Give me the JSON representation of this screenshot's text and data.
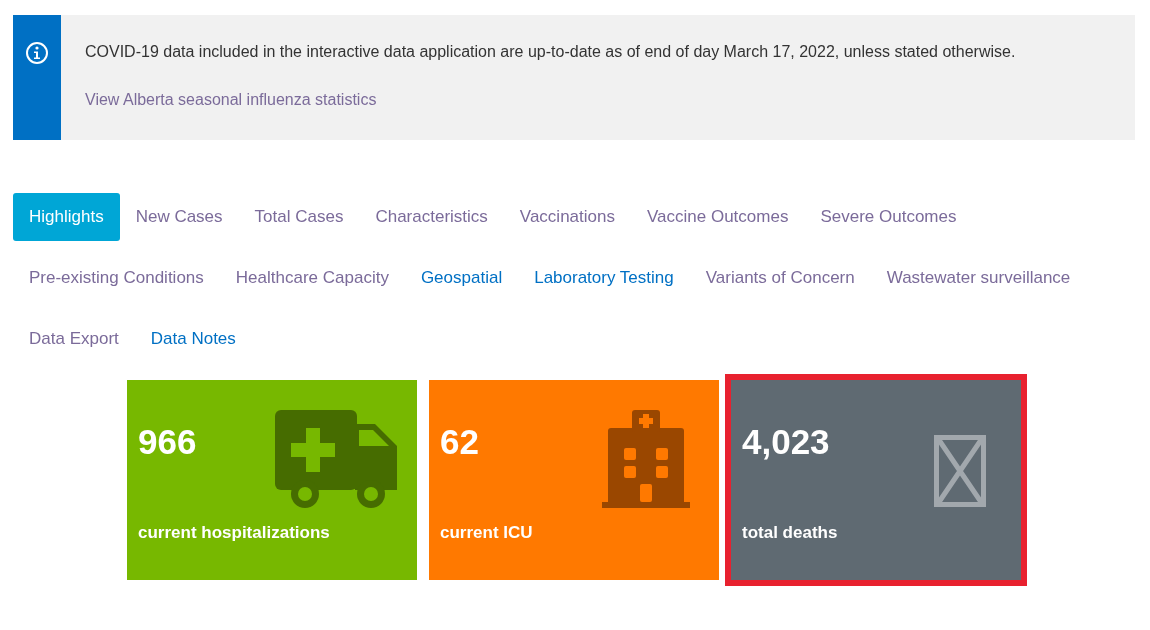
{
  "notice": {
    "message": "COVID-19 data included in the interactive data application are up-to-date as of end of day March 17, 2022, unless stated otherwise.",
    "link": "View Alberta seasonal influenza statistics"
  },
  "tabs": [
    {
      "label": "Highlights",
      "selected": true,
      "visited": false
    },
    {
      "label": "New Cases",
      "selected": false,
      "visited": true
    },
    {
      "label": "Total Cases",
      "selected": false,
      "visited": true
    },
    {
      "label": "Characteristics",
      "selected": false,
      "visited": true
    },
    {
      "label": "Vaccinations",
      "selected": false,
      "visited": true
    },
    {
      "label": "Vaccine Outcomes",
      "selected": false,
      "visited": true
    },
    {
      "label": "Severe Outcomes",
      "selected": false,
      "visited": true
    },
    {
      "label": "Pre-existing Conditions",
      "selected": false,
      "visited": true
    },
    {
      "label": "Healthcare Capacity",
      "selected": false,
      "visited": true
    },
    {
      "label": "Geospatial",
      "selected": false,
      "visited": false
    },
    {
      "label": "Laboratory Testing",
      "selected": false,
      "visited": false
    },
    {
      "label": "Variants of Concern",
      "selected": false,
      "visited": true
    },
    {
      "label": "Wastewater surveillance",
      "selected": false,
      "visited": true
    },
    {
      "label": "Data Export",
      "selected": false,
      "visited": true
    },
    {
      "label": "Data Notes",
      "selected": false,
      "visited": false
    }
  ],
  "cards": [
    {
      "value": "966",
      "label": "current hospitalizations",
      "kind": "ambulance",
      "color": "#77b800",
      "highlighted": false
    },
    {
      "value": "62",
      "label": "current ICU",
      "kind": "hospital",
      "color": "#ff7900",
      "highlighted": false
    },
    {
      "value": "4,023",
      "label": "total deaths",
      "kind": "missing",
      "color": "#5f6a72",
      "highlighted": true
    }
  ]
}
